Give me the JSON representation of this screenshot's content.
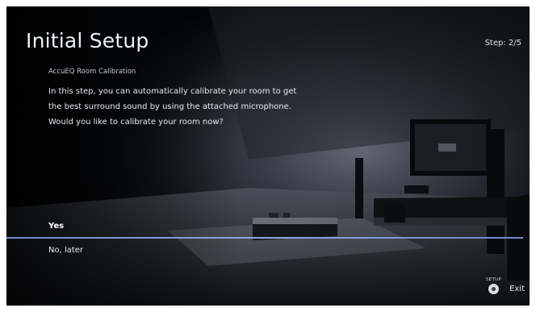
{
  "header": {
    "title": "Initial Setup",
    "step": "Step: 2/5"
  },
  "section": {
    "label": "AccuEQ Room Calibration"
  },
  "description": {
    "lines": [
      "In this step, you can automatically calibrate your room to get",
      "the best surround sound by using the attached microphone.",
      "Would you like to calibrate your room now?"
    ]
  },
  "options": {
    "yes": "Yes",
    "no": "No, later",
    "selected": "Yes"
  },
  "footer": {
    "setup_key_label": "SETUP",
    "exit_label": "Exit"
  },
  "icons": {
    "setup_button": "setup-button-icon"
  },
  "colors": {
    "background": "#05070a",
    "text": "#e8ebf0",
    "divider": "#8fa6e0"
  }
}
